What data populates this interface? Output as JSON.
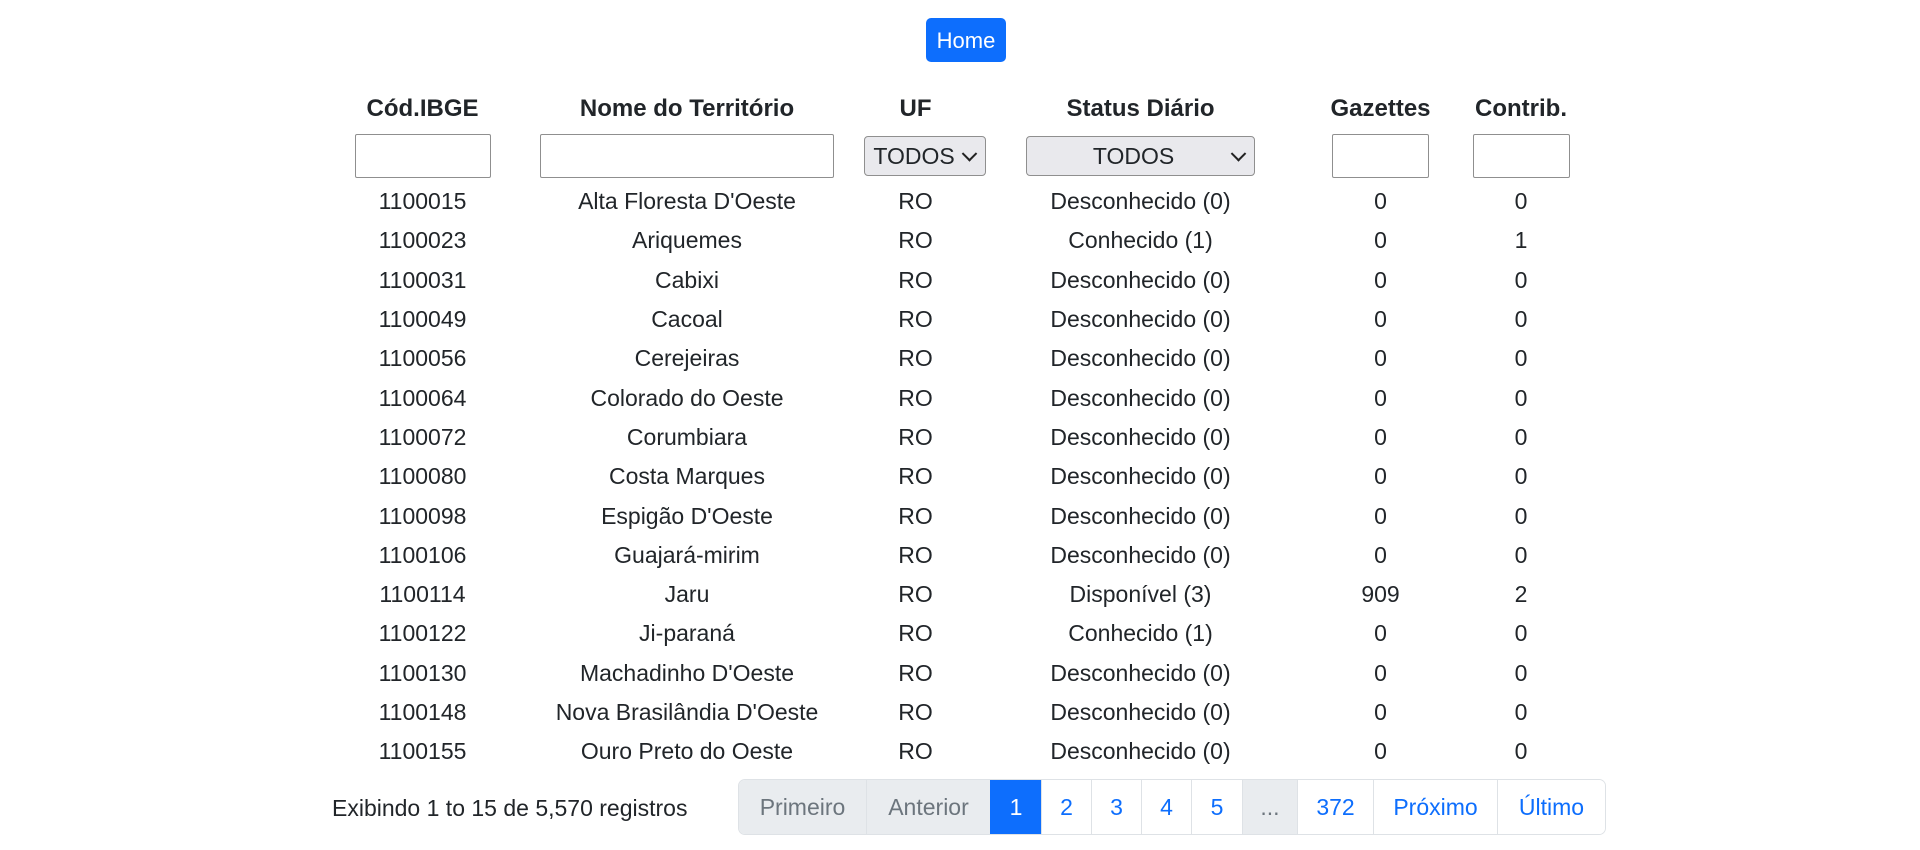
{
  "home_button": {
    "label": "Home"
  },
  "table": {
    "headers": {
      "ibge": "Cód.IBGE",
      "nome": "Nome do Território",
      "uf": "UF",
      "status": "Status Diário",
      "gazettes": "Gazettes",
      "contrib": "Contrib."
    },
    "filters": {
      "ibge_value": "",
      "nome_value": "",
      "uf_selected": "TODOS",
      "status_selected": "TODOS",
      "gazettes_value": "",
      "contrib_value": ""
    },
    "rows": [
      {
        "ibge": "1100015",
        "nome": "Alta Floresta D'Oeste",
        "uf": "RO",
        "status": "Desconhecido (0)",
        "gazettes": "0",
        "contrib": "0"
      },
      {
        "ibge": "1100023",
        "nome": "Ariquemes",
        "uf": "RO",
        "status": "Conhecido (1)",
        "gazettes": "0",
        "contrib": "1"
      },
      {
        "ibge": "1100031",
        "nome": "Cabixi",
        "uf": "RO",
        "status": "Desconhecido (0)",
        "gazettes": "0",
        "contrib": "0"
      },
      {
        "ibge": "1100049",
        "nome": "Cacoal",
        "uf": "RO",
        "status": "Desconhecido (0)",
        "gazettes": "0",
        "contrib": "0"
      },
      {
        "ibge": "1100056",
        "nome": "Cerejeiras",
        "uf": "RO",
        "status": "Desconhecido (0)",
        "gazettes": "0",
        "contrib": "0"
      },
      {
        "ibge": "1100064",
        "nome": "Colorado do Oeste",
        "uf": "RO",
        "status": "Desconhecido (0)",
        "gazettes": "0",
        "contrib": "0"
      },
      {
        "ibge": "1100072",
        "nome": "Corumbiara",
        "uf": "RO",
        "status": "Desconhecido (0)",
        "gazettes": "0",
        "contrib": "0"
      },
      {
        "ibge": "1100080",
        "nome": "Costa Marques",
        "uf": "RO",
        "status": "Desconhecido (0)",
        "gazettes": "0",
        "contrib": "0"
      },
      {
        "ibge": "1100098",
        "nome": "Espigão D'Oeste",
        "uf": "RO",
        "status": "Desconhecido (0)",
        "gazettes": "0",
        "contrib": "0"
      },
      {
        "ibge": "1100106",
        "nome": "Guajará-mirim",
        "uf": "RO",
        "status": "Desconhecido (0)",
        "gazettes": "0",
        "contrib": "0"
      },
      {
        "ibge": "1100114",
        "nome": "Jaru",
        "uf": "RO",
        "status": "Disponível (3)",
        "gazettes": "909",
        "contrib": "2"
      },
      {
        "ibge": "1100122",
        "nome": "Ji-paraná",
        "uf": "RO",
        "status": "Conhecido (1)",
        "gazettes": "0",
        "contrib": "0"
      },
      {
        "ibge": "1100130",
        "nome": "Machadinho D'Oeste",
        "uf": "RO",
        "status": "Desconhecido (0)",
        "gazettes": "0",
        "contrib": "0"
      },
      {
        "ibge": "1100148",
        "nome": "Nova Brasilândia D'Oeste",
        "uf": "RO",
        "status": "Desconhecido (0)",
        "gazettes": "0",
        "contrib": "0"
      },
      {
        "ibge": "1100155",
        "nome": "Ouro Preto do Oeste",
        "uf": "RO",
        "status": "Desconhecido (0)",
        "gazettes": "0",
        "contrib": "0"
      }
    ]
  },
  "footer": {
    "info": "Exibindo 1 to 15 de 5,570 registros"
  },
  "pagination": {
    "items": [
      {
        "label": "Primeiro",
        "state": "disabled"
      },
      {
        "label": "Anterior",
        "state": "disabled"
      },
      {
        "label": "1",
        "state": "active"
      },
      {
        "label": "2",
        "state": "normal"
      },
      {
        "label": "3",
        "state": "normal"
      },
      {
        "label": "4",
        "state": "normal"
      },
      {
        "label": "5",
        "state": "normal"
      },
      {
        "label": "...",
        "state": "disabled"
      },
      {
        "label": "372",
        "state": "normal"
      },
      {
        "label": "Próximo",
        "state": "normal"
      },
      {
        "label": "Último",
        "state": "normal"
      }
    ]
  },
  "colors": {
    "primary": "#0d6efd",
    "disabled_bg": "#e9ecef",
    "disabled_text": "#6c757d",
    "text": "#212529"
  }
}
